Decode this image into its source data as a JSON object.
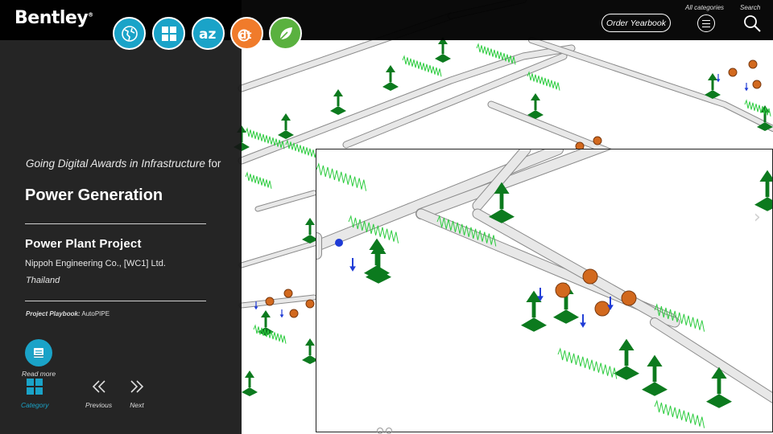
{
  "brand": {
    "logo_text": "Bentley",
    "trademark": "®"
  },
  "category_icons": [
    {
      "name": "globe-icon",
      "color": "#1aa3c8"
    },
    {
      "name": "grid-icon",
      "color": "#1aa3c8"
    },
    {
      "name": "az-icon",
      "color": "#1aa3c8",
      "text": "az"
    },
    {
      "name": "digital-twin-icon",
      "color": "#f07b2b",
      "text": "dt"
    },
    {
      "name": "leaf-icon",
      "color": "#5ab13f"
    }
  ],
  "header": {
    "order_label": "Order Yearbook",
    "all_categories_label": "All categories",
    "search_label": "Search"
  },
  "project": {
    "subtitle_italic": "Going Digital Awards in Infrastructure",
    "subtitle_plain": "for",
    "category": "Power Generation",
    "title": "Power Plant Project",
    "company": "Nippoh Engineering Co., [WC1] Ltd.",
    "country": "Thailand",
    "playbook_label": "Project Playbook:",
    "playbook_value": "AutoPIPE"
  },
  "actions": {
    "read_more": "Read more",
    "category": "Category",
    "previous": "Previous",
    "next": "Next"
  },
  "colors": {
    "accent": "#1aa3c8",
    "pipe": "#c8c8c8",
    "support": "#0c7a1e",
    "valve": "#d2691e"
  }
}
